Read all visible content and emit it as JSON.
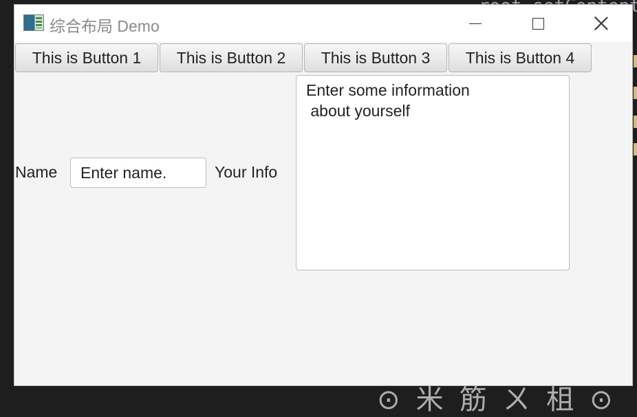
{
  "background": {
    "code_fragment": "root.setContent",
    "bottom_text": "⊙ 米 筋 ㄨ 柤 ⊙"
  },
  "window": {
    "title": "综合布局 Demo",
    "controls": {
      "minimize": "minimize",
      "maximize": "maximize",
      "close": "close"
    }
  },
  "toolbar": {
    "buttons": [
      {
        "label": "This is Button 1"
      },
      {
        "label": "This is Button 2"
      },
      {
        "label": "This is Button 3"
      },
      {
        "label": "This is Button 4"
      }
    ]
  },
  "form": {
    "name_label": "Name",
    "name_placeholder": "Enter name.",
    "info_label": "Your Info",
    "info_placeholder": "Enter some information\n about yourself"
  },
  "colors": {
    "window_bg": "#f4f4f4",
    "titlebar_bg": "#ffffff",
    "ide_bg": "#1e1e1e"
  }
}
